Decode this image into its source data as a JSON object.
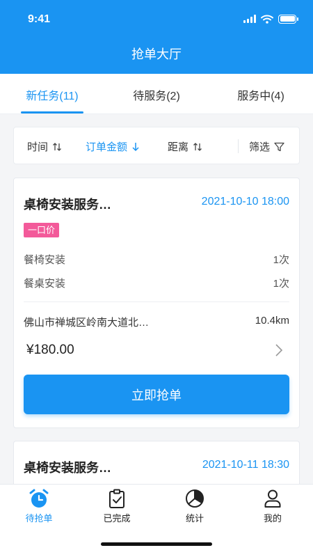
{
  "status_bar": {
    "time": "9:41"
  },
  "header": {
    "title": "抢单大厅"
  },
  "tabs": [
    {
      "label": "新任务(11)",
      "active": true
    },
    {
      "label": "待服务(2)",
      "active": false
    },
    {
      "label": "服务中(4)",
      "active": false
    }
  ],
  "sort": {
    "time_label": "时间",
    "amount_label": "订单金额",
    "distance_label": "距离",
    "filter_label": "筛选",
    "active": "订单金额"
  },
  "orders": [
    {
      "title": "桌椅安装服务…",
      "time": "2021-10-10 18:00",
      "badge": "一口价",
      "items": [
        {
          "name": "餐椅安装",
          "qty": "1次"
        },
        {
          "name": "餐桌安装",
          "qty": "1次"
        }
      ],
      "address": "佛山市禅城区岭南大道北…",
      "distance": "10.4km",
      "price": "¥180.00",
      "action_label": "立即抢单"
    },
    {
      "title": "桌椅安装服务…",
      "time": "2021-10-11 18:30"
    }
  ],
  "bottom_nav": [
    {
      "label": "待抢单",
      "icon": "alarm-clock-icon",
      "active": true
    },
    {
      "label": "已完成",
      "icon": "clipboard-check-icon",
      "active": false
    },
    {
      "label": "统计",
      "icon": "pie-chart-icon",
      "active": false
    },
    {
      "label": "我的",
      "icon": "user-icon",
      "active": false
    }
  ],
  "colors": {
    "primary": "#1a94f2",
    "badge": "#f35a9a"
  }
}
